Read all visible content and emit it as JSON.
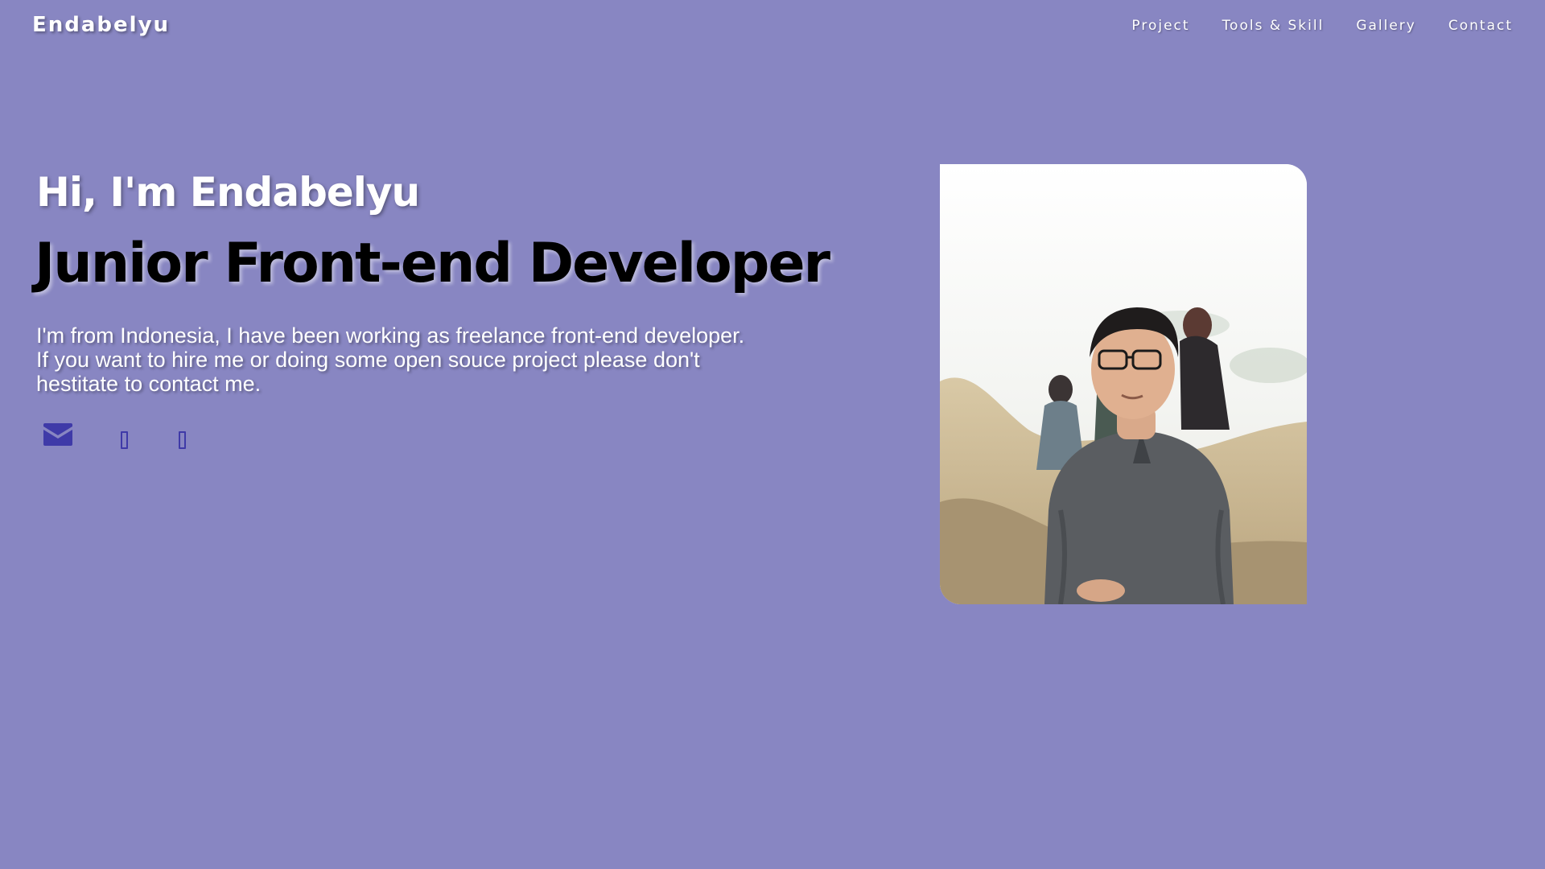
{
  "nav": {
    "brand": "Endabelyu",
    "links": [
      {
        "label": "Project"
      },
      {
        "label": "Tools & Skill"
      },
      {
        "label": "Gallery"
      },
      {
        "label": "Contact"
      }
    ]
  },
  "hero": {
    "greeting": "Hi, I'm Endabelyu",
    "role": "Junior Front-end Developer",
    "intro": "I'm from Indonesia, I have been working as freelance front-end developer. If you want to hire me or doing some open souce project please don't hestitate to contact me.",
    "socials": [
      {
        "icon": "envelope-icon"
      },
      {
        "icon": "missing-glyph-icon"
      },
      {
        "icon": "missing-glyph-icon"
      }
    ]
  },
  "colors": {
    "background": "#8886c2",
    "icon_accent": "#3f3aa8",
    "heading_dark": "#000000",
    "text_light": "#ffffff"
  }
}
